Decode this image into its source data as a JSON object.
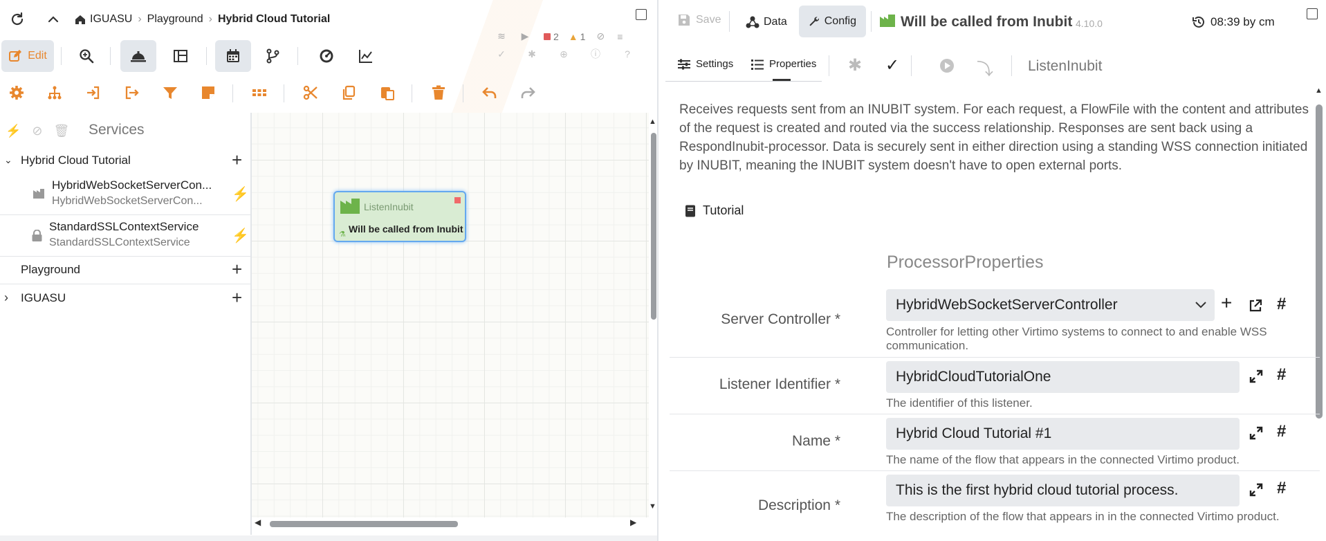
{
  "breadcrumb": {
    "items": [
      "IGUASU",
      "Playground",
      "Hybrid Cloud Tutorial"
    ]
  },
  "toolbar": {
    "edit_label": "Edit"
  },
  "status_counters": {
    "stopped": "2",
    "warnings": "1"
  },
  "services_panel": {
    "title": "Services"
  },
  "tree": {
    "group1": "Hybrid Cloud Tutorial",
    "item1_title": "HybridWebSocketServerCon...",
    "item1_sub": "HybridWebSocketServerCon...",
    "item2_title": "StandardSSLContextService",
    "item2_sub": "StandardSSLContextService",
    "group2": "Playground",
    "group3": "IGUASU"
  },
  "canvas_node": {
    "type": "ListenInubit",
    "name": "Will be called from Inubit"
  },
  "header": {
    "save_label": "Save",
    "data_tab": "Data",
    "config_tab": "Config",
    "title": "Will be called from Inubit",
    "version": "4.10.0",
    "timestamp": "08:39 by cm"
  },
  "subtabs": {
    "settings": "Settings",
    "properties": "Properties",
    "processor_type": "ListenInubit"
  },
  "description": "Receives requests sent from an INUBIT system. For each request, a FlowFile with the content and attributes of the request is created and routed via the success relationship. Responses are sent back using a RespondInubit-processor. Data is securely sent in either direction using a standing WSS connection initiated by INUBIT, meaning the INUBIT system doesn't have to open external ports.",
  "tutorial_link": "Tutorial",
  "properties_heading": "ProcessorProperties",
  "properties": [
    {
      "label": "Server Controller *",
      "value": "HybridWebSocketServerController",
      "hint": "Controller for letting other Virtimo systems to connect to and enable WSS communication."
    },
    {
      "label": "Listener Identifier *",
      "value": "HybridCloudTutorialOne",
      "hint": "The identifier of this listener."
    },
    {
      "label": "Name *",
      "value": "Hybrid Cloud Tutorial #1",
      "hint": "The name of the flow that appears in the connected Virtimo product."
    },
    {
      "label": "Description *",
      "value": "This is the first hybrid cloud tutorial process.",
      "hint": "The description of the flow that appears in in the connected Virtimo product."
    }
  ],
  "hash_symbol": "#",
  "colors": {
    "accent_orange": "#e8872e",
    "blue": "#3b7dd8",
    "node_green": "#6db34a",
    "node_bg": "#d9ecd3"
  }
}
